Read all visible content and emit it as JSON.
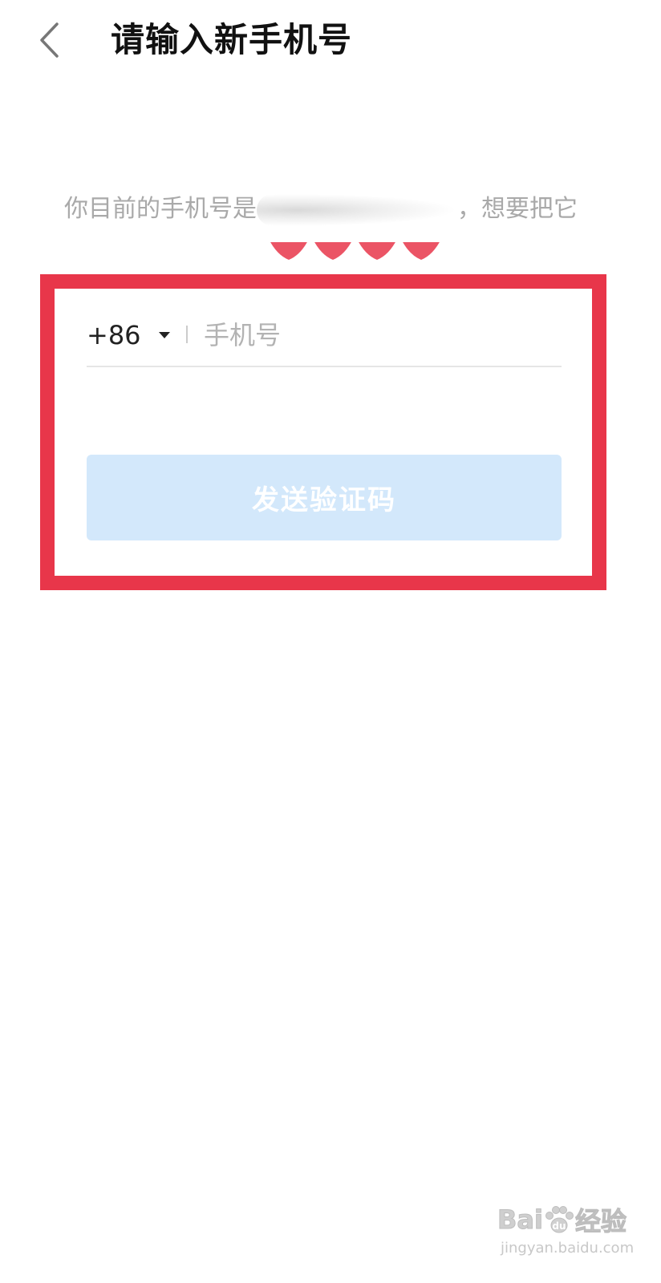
{
  "header": {
    "back_icon": "chevron-left-icon",
    "title": "请输入新手机号"
  },
  "description": {
    "prefix": "你目前的手机号是",
    "suffix": "，想要把它"
  },
  "form": {
    "country_code": "+86",
    "phone_placeholder": "手机号",
    "phone_value": "",
    "send_button_label": "发送验证码"
  },
  "watermark": {
    "brand": "Bai",
    "brand_tail": "经验",
    "url": "jingyan.baidu.com"
  },
  "colors": {
    "highlight_border": "#e8364a",
    "button_bg": "#d3e8fb",
    "muted_text": "#a9a9a9"
  }
}
